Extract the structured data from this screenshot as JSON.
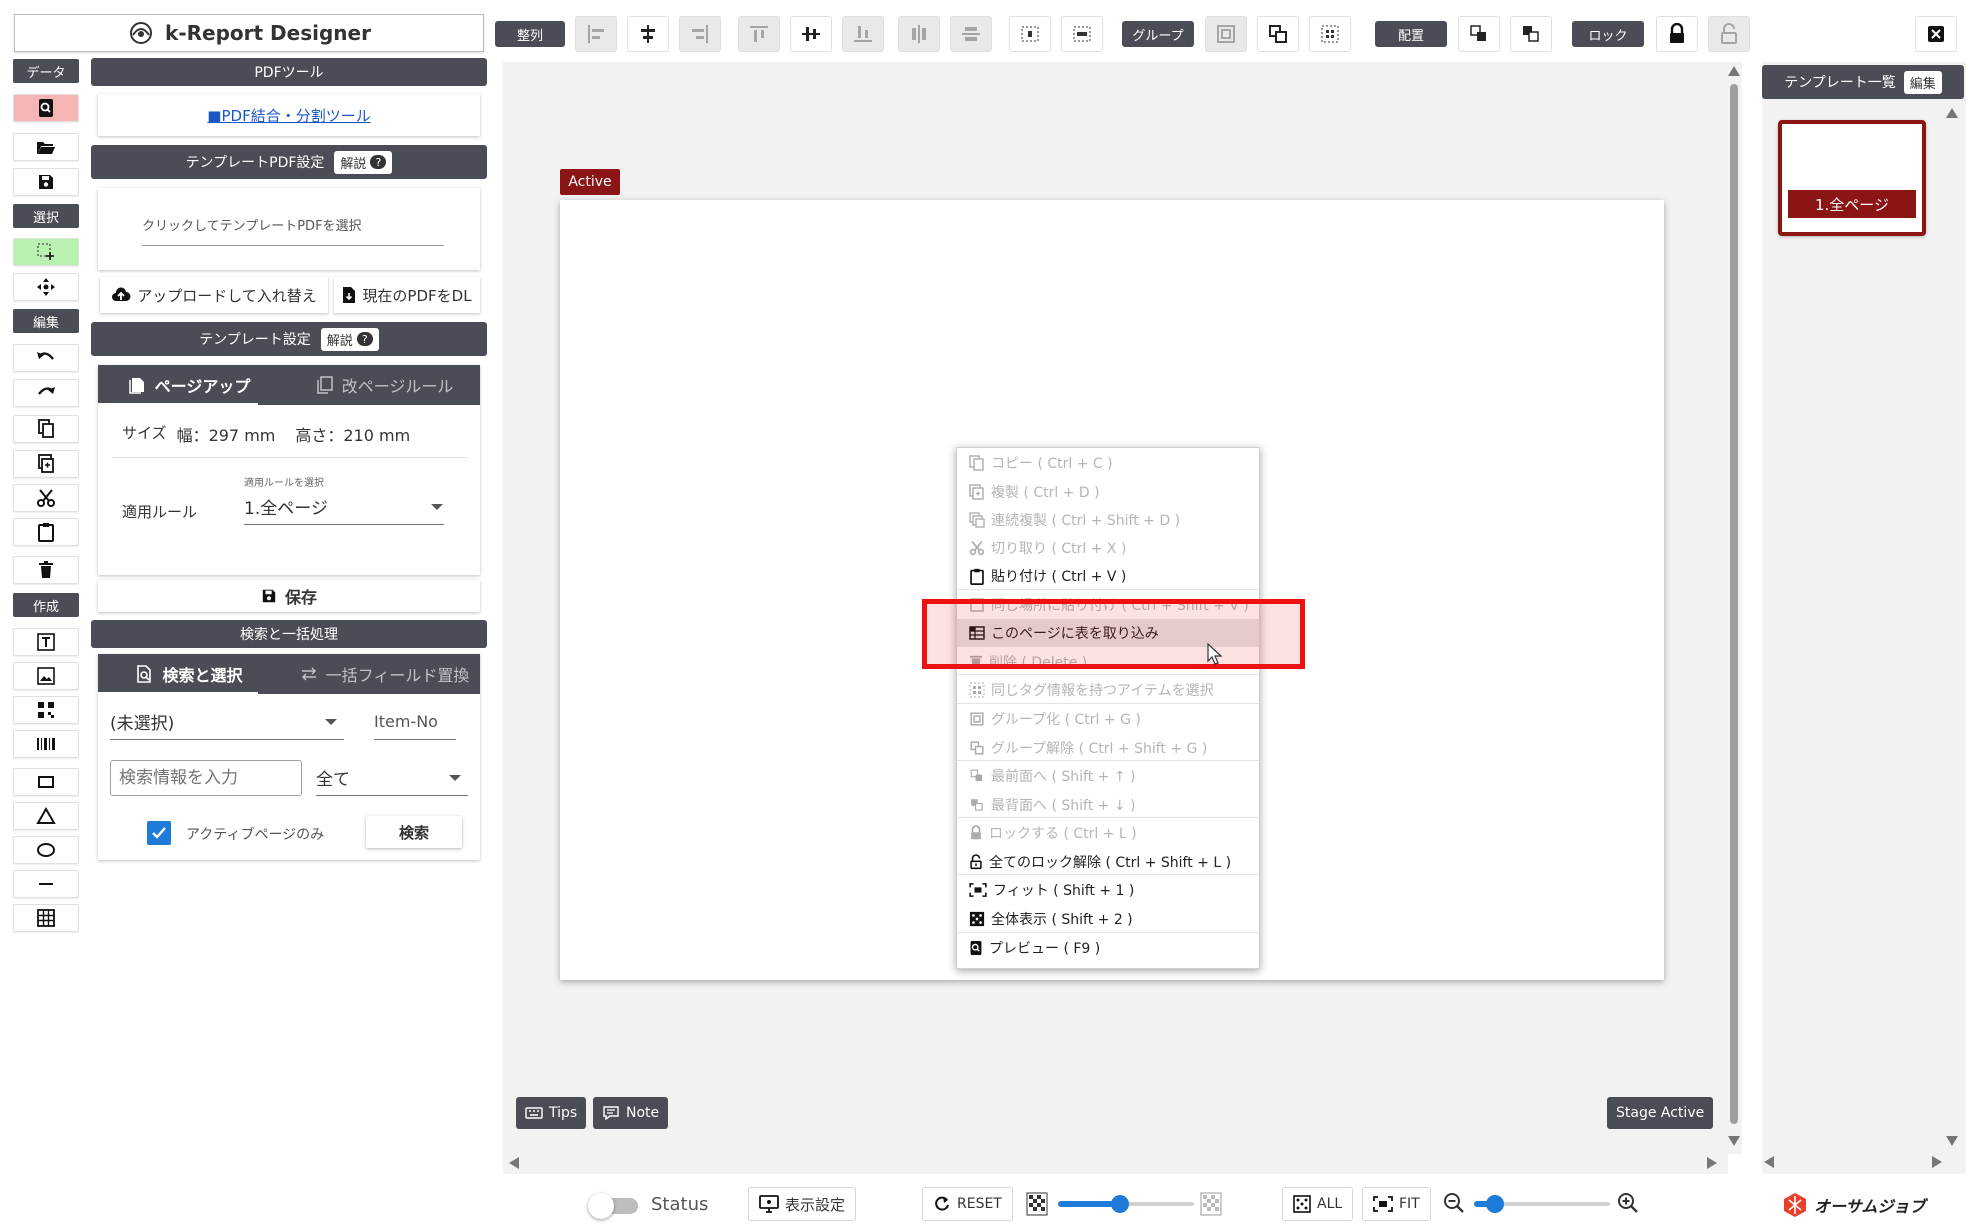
{
  "app": {
    "title": "k-Report Designer",
    "close_icon": "close-icon"
  },
  "toolbar": {
    "align_label": "整列",
    "group_label": "グループ",
    "arrange_label": "配置",
    "lock_label": "ロック"
  },
  "left_sidebar": {
    "sections": {
      "data": "データ",
      "select": "選択",
      "edit": "編集",
      "create": "作成"
    }
  },
  "left_panel": {
    "pdf_tools": {
      "header": "PDFツール",
      "link": "■PDF結合・分割ツール"
    },
    "template_pdf": {
      "header": "テンプレートPDF設定",
      "help": "解説",
      "placeholder": "クリックしてテンプレートPDFを選択",
      "upload_button": "アップロードして入れ替え",
      "download_button": "現在のPDFをDL"
    },
    "template_settings": {
      "header": "テンプレート設定",
      "help": "解説",
      "tabs": [
        "ページアップ",
        "改ページルール"
      ],
      "size_label": "サイズ",
      "width_text": "幅：297 mm",
      "height_text": "高さ：210 mm",
      "rule_select_caption": "適用ルールを選択",
      "rule_label": "適用ルール",
      "rule_value": "1.全ページ",
      "save_button": "保存"
    },
    "search": {
      "header": "検索と一括処理",
      "tabs": [
        "検索と選択",
        "一括フィールド置換"
      ],
      "field_select": "(未選択)",
      "item_no": "Item-No",
      "search_placeholder": "検索情報を入力",
      "scope_select": "全て",
      "active_only_label": "アクティブページのみ",
      "active_only_checked": true,
      "search_button": "検索"
    }
  },
  "stage": {
    "active_badge": "Active",
    "tips_button": "Tips",
    "note_button": "Note",
    "stage_active_button": "Stage Active"
  },
  "context_menu": {
    "items": [
      {
        "label": "コピー ( Ctrl + C )",
        "enabled": false,
        "icon": "copy-icon"
      },
      {
        "label": "複製 ( Ctrl + D )",
        "enabled": false,
        "icon": "duplicate-icon"
      },
      {
        "label": "連続複製 ( Ctrl + Shift + D )",
        "enabled": false,
        "icon": "multi-duplicate-icon"
      },
      {
        "label": "切り取り ( Ctrl + X )",
        "enabled": false,
        "icon": "scissors-icon"
      },
      {
        "label": "貼り付け ( Ctrl + V )",
        "enabled": true,
        "icon": "clipboard-icon"
      },
      {
        "label": "同じ場所に貼り付け ( Ctrl + Shift + V )",
        "enabled": false,
        "icon": "paste-same-icon"
      },
      {
        "label": "このページに表を取り込み",
        "enabled": true,
        "icon": "table-import-icon",
        "highlighted": true
      },
      {
        "label": "削除 ( Delete )",
        "enabled": false,
        "icon": "delete-icon"
      },
      {
        "label": "同じタグ情報を持つアイテムを選択",
        "enabled": false,
        "icon": "tag-select-icon"
      },
      {
        "label": "グループ化 ( Ctrl + G )",
        "enabled": false,
        "icon": "group-icon"
      },
      {
        "label": "グループ解除 ( Ctrl + Shift + G )",
        "enabled": false,
        "icon": "ungroup-icon"
      },
      {
        "label": "最前面へ ( Shift + ↑ )",
        "enabled": false,
        "icon": "bring-front-icon"
      },
      {
        "label": "最背面へ ( Shift + ↓ )",
        "enabled": false,
        "icon": "send-back-icon"
      },
      {
        "label": "ロックする ( Ctrl + L )",
        "enabled": false,
        "icon": "lock-icon"
      },
      {
        "label": "全てのロック解除 ( Ctrl + Shift + L )",
        "enabled": true,
        "icon": "unlock-icon"
      },
      {
        "label": "フィット ( Shift + 1 )",
        "enabled": true,
        "icon": "fit-icon"
      },
      {
        "label": "全体表示 ( Shift + 2 )",
        "enabled": true,
        "icon": "show-all-icon"
      },
      {
        "label": "プレビュー ( F9 )",
        "enabled": true,
        "icon": "preview-icon"
      }
    ]
  },
  "template_list": {
    "header": "テンプレート一覧",
    "edit_button": "編集",
    "items": [
      {
        "label": "1.全ページ",
        "selected": true
      }
    ]
  },
  "bottom_bar": {
    "status_label": "Status",
    "status_on": false,
    "display_settings": "表示設定",
    "reset": "RESET",
    "all": "ALL",
    "fit": "FIT",
    "opacity_level": 0.45,
    "zoom_level": 0.1,
    "logo_text": "オーサムジョブ"
  },
  "colors": {
    "dark": "#4a4d55",
    "accent_red": "#8b1414",
    "highlight_red": "#ee1111",
    "slider_blue": "#1e7bd8"
  }
}
